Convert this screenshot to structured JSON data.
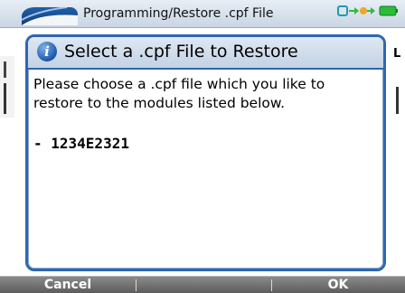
{
  "window": {
    "title": "Programming/Restore .cpf File"
  },
  "background": {
    "right_partial_text": "L"
  },
  "dialog": {
    "title": "Select a .cpf File to Restore",
    "message": "Please choose a .cpf file which you like to restore to the modules listed below.",
    "modules": [
      "- 1234E2321"
    ]
  },
  "softkeys": {
    "left": "Cancel",
    "right": "OK"
  },
  "colors": {
    "accent": "#2f67b0",
    "softbar": "#6f6f6f"
  },
  "icons": {
    "title_logo": "app-logo",
    "status": "connection-battery-icon",
    "dialog": "info-icon"
  }
}
